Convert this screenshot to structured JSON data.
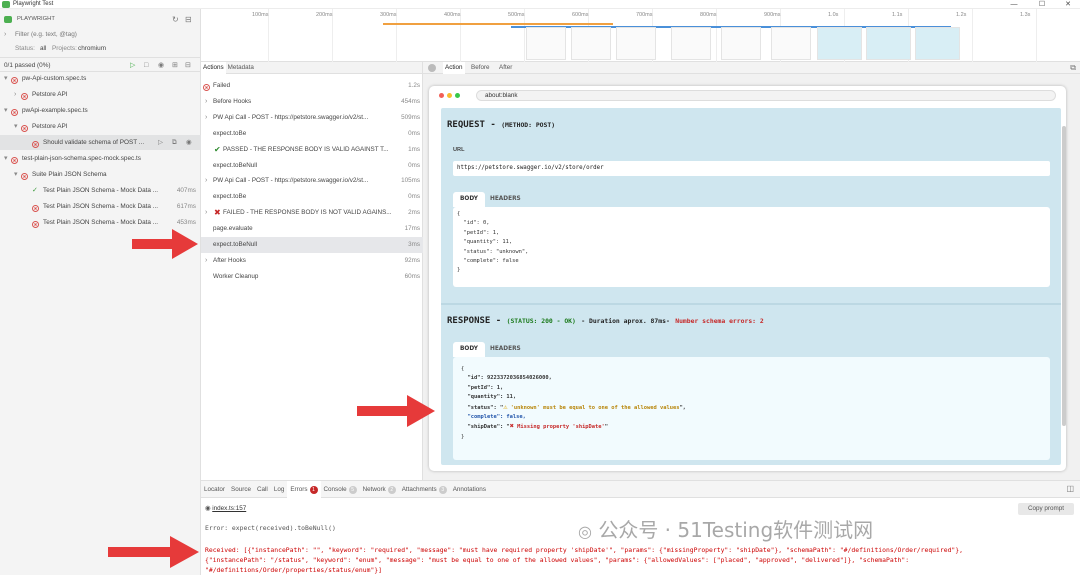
{
  "window": {
    "title": "Playwright Test",
    "controls": [
      "—",
      "☐",
      "✕"
    ]
  },
  "sidebar": {
    "brand": "PLAYWRIGHT",
    "filter_placeholder": "Filter (e.g. text, @tag)",
    "status_label": "Status:",
    "status_value": "all",
    "projects_label": "Projects:",
    "projects_value": "chromium",
    "summary": "0/1 passed (0%)",
    "tree": [
      {
        "label": "pw-Api-custom.spec.ts",
        "depth": 0,
        "status": "failed",
        "chev": "▾"
      },
      {
        "label": "Petstore API",
        "depth": 1,
        "status": "failed",
        "chev": "›"
      },
      {
        "label": "pwApi-example.spec.ts",
        "depth": 0,
        "status": "failed",
        "chev": "▾"
      },
      {
        "label": "Petstore API",
        "depth": 1,
        "status": "failed",
        "chev": "▾"
      },
      {
        "label": "Should validate schema of POST ...",
        "depth": 2,
        "status": "failed",
        "chev": "",
        "selected": true
      },
      {
        "label": "test-plain-json-schema.spec-mock.spec.ts",
        "depth": 0,
        "status": "failed",
        "chev": "▾"
      },
      {
        "label": "Suite Plain JSON Schema",
        "depth": 1,
        "status": "failed",
        "chev": "▾"
      },
      {
        "label": "Test Plain JSON Schema - Mock Data ...",
        "depth": 2,
        "status": "passed",
        "chev": "",
        "time": "407ms"
      },
      {
        "label": "Test Plain JSON Schema - Mock Data ...",
        "depth": 2,
        "status": "failed",
        "chev": "",
        "time": "617ms"
      },
      {
        "label": "Test Plain JSON Schema - Mock Data ...",
        "depth": 2,
        "status": "failed",
        "chev": "",
        "time": "453ms"
      }
    ]
  },
  "timeline": {
    "ticks": [
      "100ms",
      "200ms",
      "300ms",
      "400ms",
      "500ms",
      "600ms",
      "700ms",
      "800ms",
      "900ms",
      "1.0s",
      "1.1s",
      "1.2s",
      "1.3s"
    ]
  },
  "actions": {
    "tabs": [
      "Actions",
      "Metadata"
    ],
    "rows": [
      {
        "label": "Failed",
        "time": "1.2s",
        "kind": "failed",
        "indent": 0
      },
      {
        "label": "Before Hooks",
        "time": "454ms",
        "kind": "chev",
        "indent": 0
      },
      {
        "label": "PW Api Call - POST - https://petstore.swagger.io/v2/st...",
        "time": "509ms",
        "kind": "chev",
        "indent": 0
      },
      {
        "label": "expect.toBe",
        "time": "0ms",
        "kind": "none",
        "indent": 1
      },
      {
        "label": "PASSED - THE RESPONSE BODY IS VALID AGAINST T...",
        "time": "1ms",
        "kind": "pass",
        "indent": 1
      },
      {
        "label": "expect.toBeNull",
        "time": "0ms",
        "kind": "none",
        "indent": 1
      },
      {
        "label": "PW Api Call - POST - https://petstore.swagger.io/v2/st...",
        "time": "105ms",
        "kind": "chev",
        "indent": 0
      },
      {
        "label": "expect.toBe",
        "time": "0ms",
        "kind": "none",
        "indent": 1
      },
      {
        "label": "FAILED - THE RESPONSE BODY IS NOT VALID AGAINS...",
        "time": "2ms",
        "kind": "fail",
        "indent": 0
      },
      {
        "label": "page.evaluate",
        "time": "17ms",
        "kind": "none",
        "indent": 1
      },
      {
        "label": "expect.toBeNull",
        "time": "3ms",
        "kind": "none",
        "indent": 1,
        "selected": true
      },
      {
        "label": "After Hooks",
        "time": "92ms",
        "kind": "chev",
        "indent": 0
      },
      {
        "label": "Worker Cleanup",
        "time": "60ms",
        "kind": "none",
        "indent": 1
      }
    ]
  },
  "preview": {
    "tabs": [
      "Action",
      "Before",
      "After"
    ],
    "address": "about:blank",
    "request": {
      "title": "REQUEST -",
      "method": "(METHOD: POST)",
      "url_label": "URL",
      "url": "https://petstore.swagger.io/v2/store/order",
      "tab_body": "BODY",
      "tab_headers": "HEADERS",
      "body_lines": [
        "{",
        "  \"id\": 0,",
        "  \"petId\": 1,",
        "  \"quantity\": 11,",
        "  \"status\": \"unknown\",",
        "  \"complete\": false",
        "}"
      ]
    },
    "response": {
      "title": "RESPONSE -",
      "status": "(STATUS: 200 - OK)",
      "duration": "- Duration aprox. 87ms-",
      "errors": "Number schema errors: 2",
      "tab_body": "BODY",
      "tab_headers": "HEADERS",
      "body_open": "{",
      "id_line": "  \"id\": 9223372036854026000,",
      "petid_line": "  \"petId\": 1,",
      "qty_line": "  \"quantity\": 11,",
      "status_key": "  \"status\": \"",
      "status_msg": "'unknown' must be equal to one of the allowed values",
      "status_tail": "\",",
      "complete_line": "  \"complete\": false,",
      "ship_key": "  \"shipDate\": \"",
      "ship_msg": "Missing property 'shipDate'",
      "ship_tail": "\"",
      "body_close": "}"
    }
  },
  "bottom": {
    "tabs": [
      {
        "label": "Locator"
      },
      {
        "label": "Source"
      },
      {
        "label": "Call"
      },
      {
        "label": "Log"
      },
      {
        "label": "Errors",
        "badge": "1",
        "red": true
      },
      {
        "label": "Console",
        "badge": "5"
      },
      {
        "label": "Network",
        "badge": "2"
      },
      {
        "label": "Attachments",
        "badge": "3"
      },
      {
        "label": "Annotations"
      }
    ],
    "file": "index.ts:157",
    "copy_prompt": "Copy prompt",
    "error_line": "Error: expect(received).toBeNull()",
    "received_1": "Received: [{\"instancePath\": \"\", \"keyword\": \"required\", \"message\": \"must have required property 'shipDate'\", \"params\": {\"missingProperty\": \"shipDate\"}, \"schemaPath\": \"#/definitions/Order/required\"},",
    "received_2": "{\"instancePath\": \"/status\", \"keyword\": \"enum\", \"message\": \"must be equal to one of the allowed values\", \"params\": {\"allowedValues\": [\"placed\", \"approved\", \"delivered\"]}, \"schemaPath\":",
    "received_3": "\"#/definitions/Order/properties/status/enum\"}]"
  },
  "watermark": "公众号 · 51Testing软件测试网"
}
